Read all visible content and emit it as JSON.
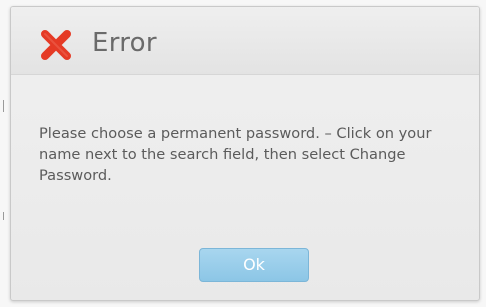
{
  "dialog": {
    "title": "Error",
    "message": "Please choose a permanent password. – Click on your name next to the search field, then select Change Password.",
    "ok_label": "Ok",
    "icon": "error-x-icon"
  },
  "colors": {
    "error_icon": "#e53a25",
    "button_fill": "#98cdea",
    "title_text": "#6a6a6a",
    "body_text": "#5b5b5b"
  }
}
